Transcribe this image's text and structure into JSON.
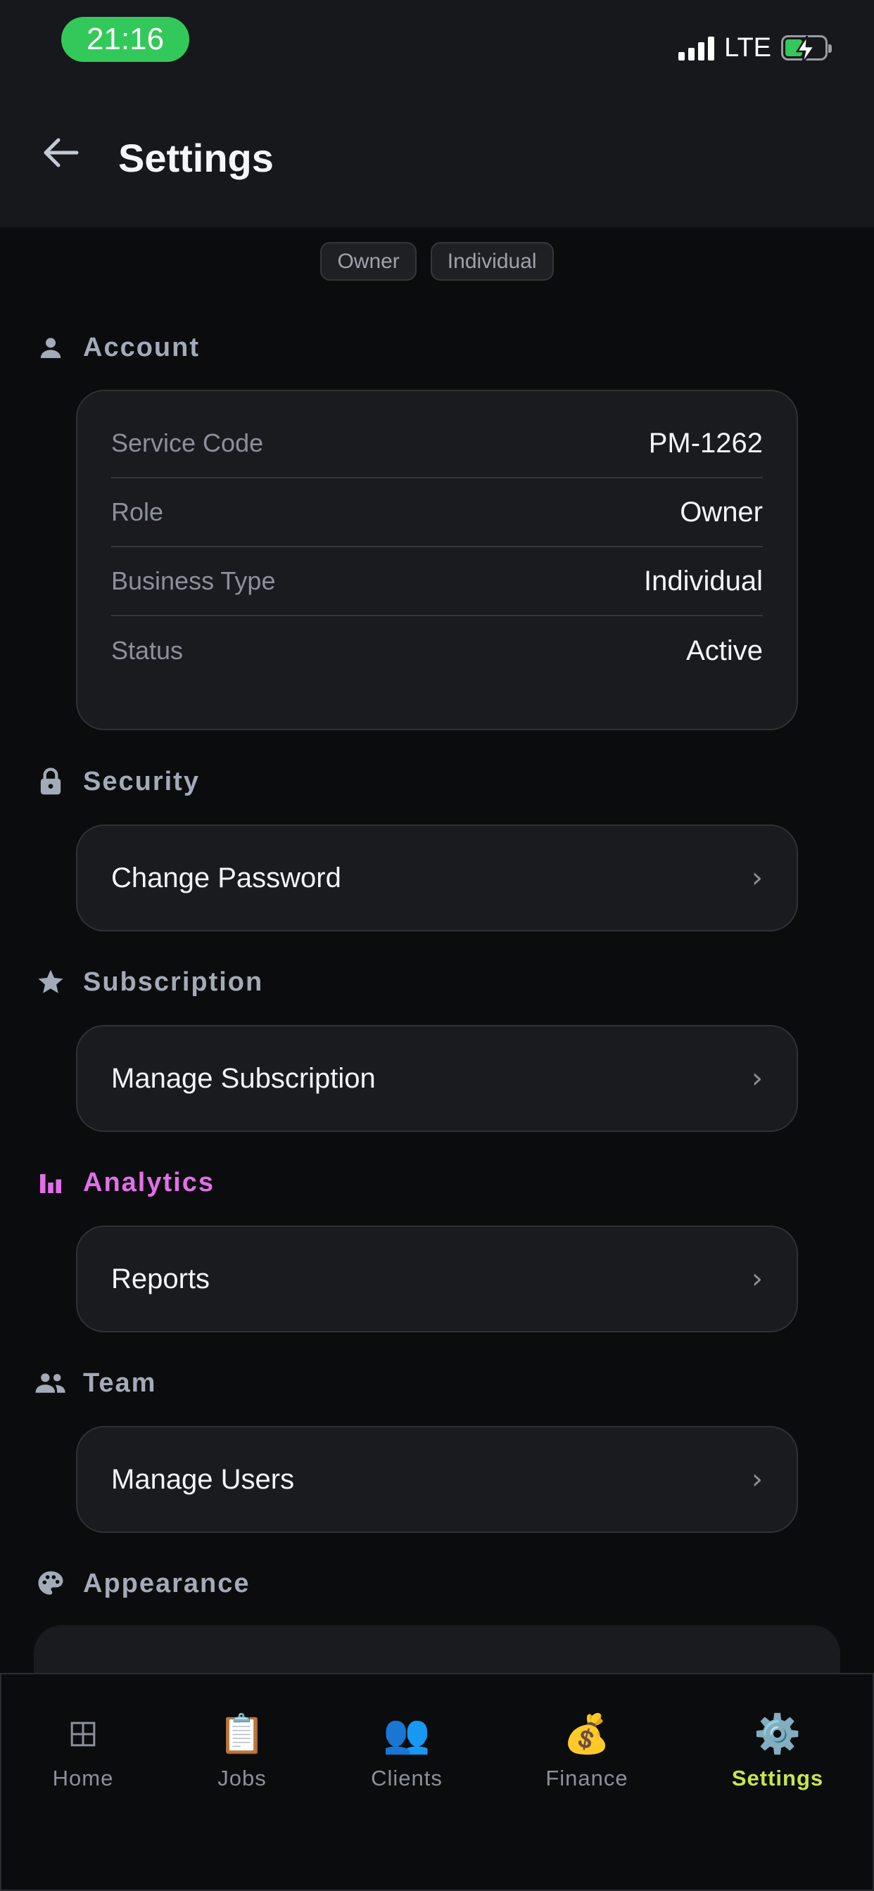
{
  "status_bar": {
    "time": "21:16",
    "network": "LTE"
  },
  "header": {
    "title": "Settings"
  },
  "chips": [
    "Owner",
    "Individual"
  ],
  "sections": {
    "account": {
      "label": "Account"
    },
    "security": {
      "label": "Security"
    },
    "subscription": {
      "label": "Subscription"
    },
    "analytics": {
      "label": "Analytics"
    },
    "team": {
      "label": "Team"
    },
    "appearance": {
      "label": "Appearance"
    }
  },
  "account": {
    "rows": [
      {
        "label": "Service Code",
        "value": "PM-1262"
      },
      {
        "label": "Role",
        "value": "Owner"
      },
      {
        "label": "Business Type",
        "value": "Individual"
      },
      {
        "label": "Status",
        "value": "Active"
      }
    ]
  },
  "actions": {
    "change_password": "Change Password",
    "manage_subscription": "Manage Subscription",
    "reports": "Reports",
    "manage_users": "Manage Users",
    "chevron": "›"
  },
  "bottom_nav": {
    "active": "Settings",
    "tabs": [
      {
        "label": "Home",
        "icon": "grid-icon",
        "glyph": "⊞"
      },
      {
        "label": "Jobs",
        "icon": "clipboard-icon",
        "glyph": "📋"
      },
      {
        "label": "Clients",
        "icon": "people-icon",
        "glyph": "👥"
      },
      {
        "label": "Finance",
        "icon": "money-bag-icon",
        "glyph": "💰"
      },
      {
        "label": "Settings",
        "icon": "gear-icon",
        "glyph": "⚙️"
      }
    ]
  },
  "colors": {
    "background": "#0b0c0e",
    "surface": "#1a1b1f",
    "header": "#17181b",
    "time_pill": "#33c95a",
    "analytics_accent": "#e26fe9",
    "active_tab": "#c7e84b",
    "section_label": "#a3aab8"
  }
}
